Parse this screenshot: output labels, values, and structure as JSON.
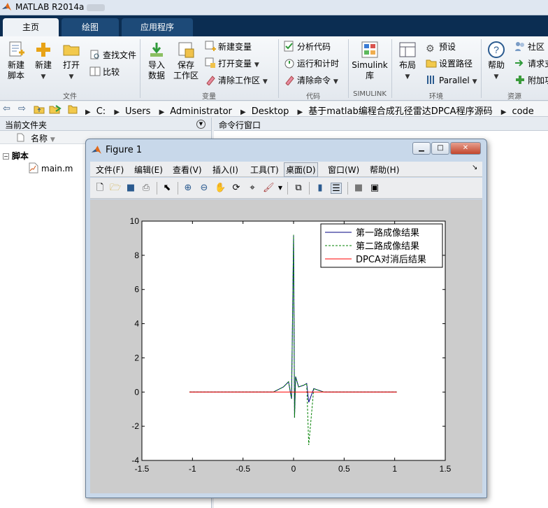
{
  "app": {
    "title": "MATLAB R2014a"
  },
  "tabs": [
    "主页",
    "绘图",
    "应用程序"
  ],
  "ribbon": {
    "file": {
      "new_script": [
        "新建",
        "脚本"
      ],
      "new": "新建",
      "open": "打开",
      "find_files": "查找文件",
      "compare": "比较",
      "label": "文件"
    },
    "variable": {
      "import": [
        "导入",
        "数据"
      ],
      "save_ws": [
        "保存",
        "工作区"
      ],
      "new_var": "新建变量",
      "open_var": "打开变量",
      "clear_ws": "清除工作区",
      "label": "变量"
    },
    "code": {
      "analyze": "分析代码",
      "run_time": "运行和计时",
      "clear_cmd": "清除命令",
      "label": "代码"
    },
    "simulink": {
      "lib": [
        "Simulink",
        "库"
      ],
      "label": "SIMULINK"
    },
    "env": {
      "layout": "布局",
      "prefs": "预设",
      "set_path": "设置路径",
      "parallel": "Parallel",
      "label": "环境"
    },
    "resources": {
      "help": "帮助",
      "community": "社区",
      "request": "请求支",
      "addons": "附加功",
      "label": "资源"
    }
  },
  "address": {
    "crumbs": [
      "C:",
      "Users",
      "Administrator",
      "Desktop",
      "基于matlab编程合成孔径雷达DPCA程序源码",
      "code"
    ]
  },
  "left_panel": {
    "title": "当前文件夹",
    "col_name": "名称",
    "folder": "脚本",
    "file": "main.m"
  },
  "right_panel": {
    "title": "命令行窗口"
  },
  "figure": {
    "title": "Figure 1",
    "menu": [
      "文件(F)",
      "编辑(E)",
      "查看(V)",
      "插入(I)",
      "工具(T)",
      "桌面(D)",
      "窗口(W)",
      "帮助(H)"
    ],
    "active_menu": "桌面(D)"
  },
  "chart_data": {
    "type": "line",
    "xlim": [
      -1.5,
      1.5
    ],
    "ylim": [
      -4,
      10
    ],
    "xticks": [
      -1.5,
      -1,
      -0.5,
      0,
      0.5,
      1,
      1.5
    ],
    "yticks": [
      -4,
      -2,
      0,
      2,
      4,
      6,
      8,
      10
    ],
    "legend_position": "top-right",
    "series": [
      {
        "name": "第一路成像结果",
        "color": "#000080",
        "style": "solid",
        "x": [
          -1.03,
          -0.2,
          -0.1,
          -0.05,
          -0.02,
          0,
          0.01,
          0.02,
          0.05,
          0.1,
          0.13,
          0.15,
          0.2,
          0.3,
          1.02
        ],
        "y": [
          0,
          0,
          0.3,
          0.6,
          -0.4,
          9.2,
          -1.5,
          0.9,
          0.3,
          0.4,
          0.5,
          -0.6,
          0.2,
          0,
          0
        ]
      },
      {
        "name": "第二路成像结果",
        "color": "#008000",
        "style": "dashed",
        "x": [
          -1.03,
          -0.2,
          -0.1,
          -0.05,
          -0.02,
          0,
          0.01,
          0.02,
          0.05,
          0.1,
          0.13,
          0.15,
          0.2,
          0.3,
          1.02
        ],
        "y": [
          0,
          0,
          0.3,
          0.6,
          -0.4,
          9.2,
          -1.5,
          0.9,
          0.3,
          0.4,
          0.5,
          -3.1,
          0.2,
          0,
          0
        ]
      },
      {
        "name": "DPCA对消后结果",
        "color": "#ff0000",
        "style": "solid",
        "x": [
          -1.03,
          0,
          0.15,
          1.02
        ],
        "y": [
          0,
          0,
          0,
          0
        ]
      }
    ]
  }
}
